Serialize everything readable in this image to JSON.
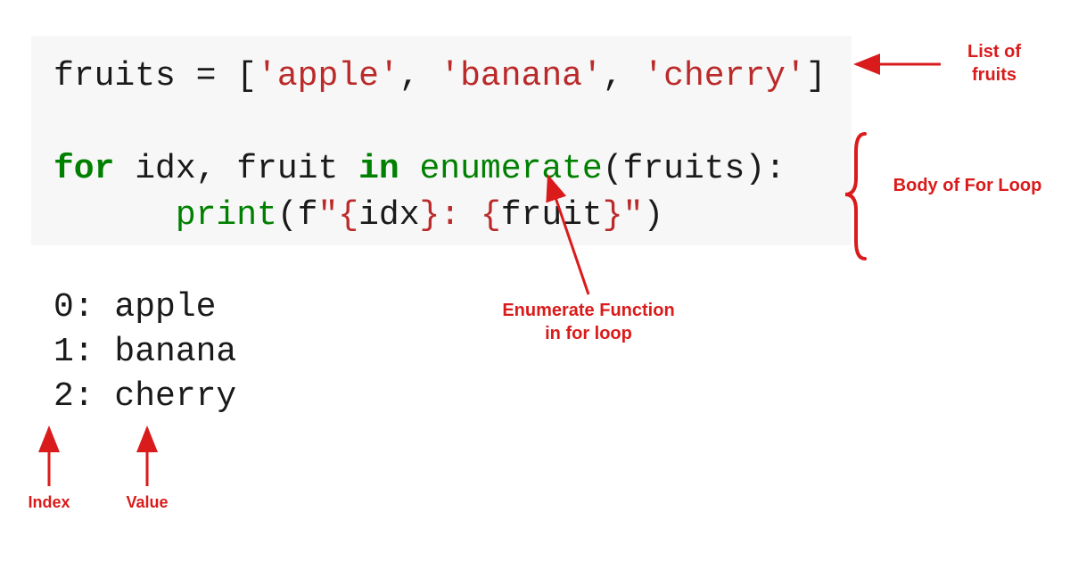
{
  "code": {
    "line1": {
      "pre": "fruits = [",
      "s1": "'apple'",
      "c1": ", ",
      "s2": "'banana'",
      "c2": ", ",
      "s3": "'cherry'",
      "post": "]"
    },
    "line2": {
      "for_kw": "for",
      "vars": " idx, fruit ",
      "in_kw": "in",
      "space1": " ",
      "enum": "enumerate",
      "after_enum": "(fruits):"
    },
    "line3": {
      "indent": "      ",
      "print_fn": "print",
      "open": "(f",
      "q1": "\"",
      "brace1o": "{",
      "idx": "idx",
      "brace1c": "}",
      "colon": ": ",
      "brace2o": "{",
      "fruit": "fruit",
      "brace2c": "}",
      "q2": "\"",
      "close": ")"
    }
  },
  "output": {
    "lines": [
      "0: apple",
      "1: banana",
      "2: cherry"
    ]
  },
  "annotations": {
    "list_of_fruits": "List of\nfruits",
    "body_of_loop": "Body of For Loop",
    "enumerate_fn": "Enumerate Function\nin for loop",
    "index": "Index",
    "value": "Value"
  },
  "colors": {
    "accent": "#da1b1b",
    "code_bg": "#f7f7f7",
    "keyword": "#008000",
    "string": "#bb2a2a"
  }
}
